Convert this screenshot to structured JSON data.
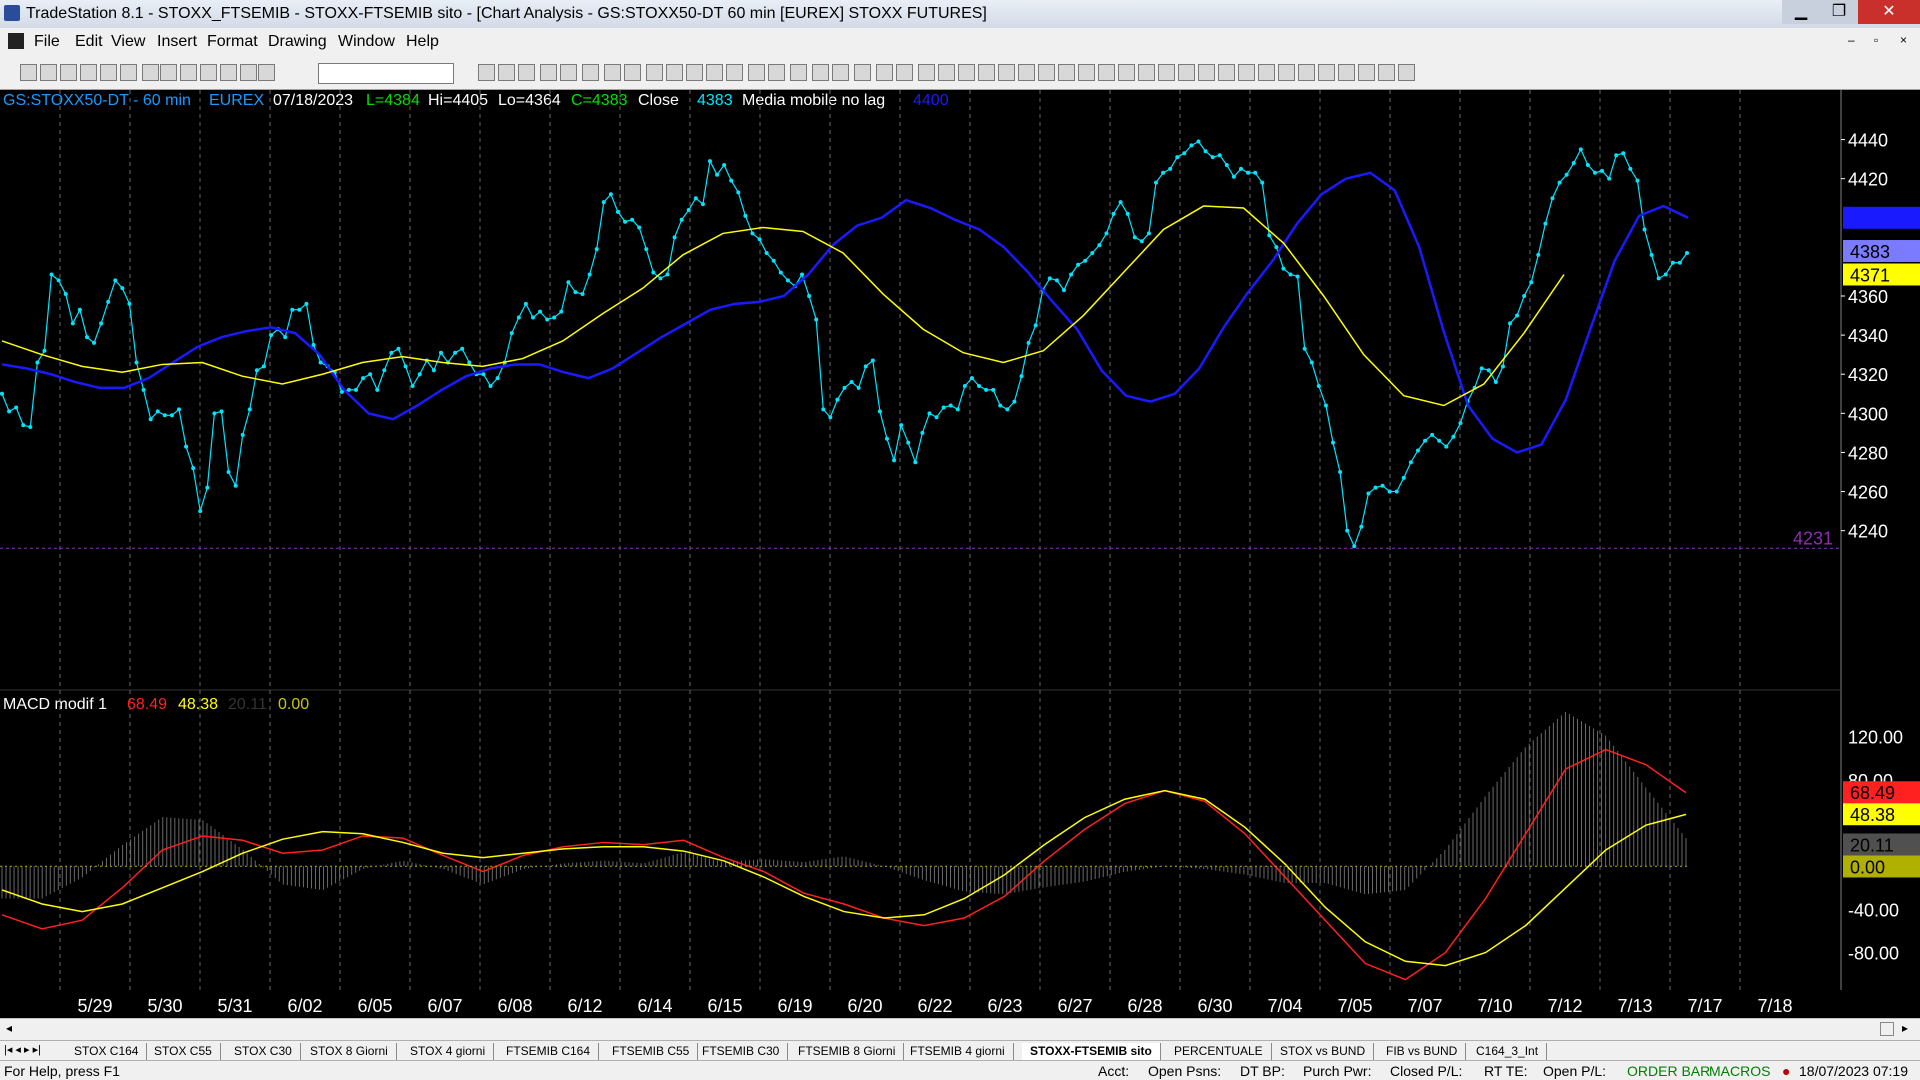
{
  "window": {
    "title": "TradeStation 8.1 - STOXX_FTSEMIB - STOXX-FTSEMIB sito - [Chart Analysis - GS:STOXX50-DT  60 min  [EUREX] STOXX FUTURES]",
    "minimize": "▁",
    "maximize": "❐",
    "close": "✕"
  },
  "menu": {
    "items": [
      "File",
      "Edit",
      "View",
      "Insert",
      "Format",
      "Drawing",
      "Window",
      "Help"
    ]
  },
  "toolbar": {
    "combo_value": ""
  },
  "chart_header": {
    "symbol": "GS:STOXX50-DT - 60 min",
    "exchange": "EUREX",
    "date": "07/18/2023",
    "last": "L=4384",
    "high": "Hi=4405",
    "low": "Lo=4364",
    "close": "C=4383",
    "close_label": "Close",
    "close_value": "4383",
    "ma_label": "Media mobile no lag",
    "ma_value": "4400"
  },
  "macd_header": {
    "name": "MACD modif 1",
    "v1": "68.49",
    "v2": "48.38",
    "v3": "20.11",
    "v4": "0.00"
  },
  "chart_data": [
    {
      "type": "line",
      "title": "",
      "x_axis_dates": [
        "5/29",
        "5/30",
        "5/31",
        "6/02",
        "6/05",
        "6/07",
        "6/08",
        "6/12",
        "6/14",
        "6/15",
        "6/19",
        "6/20",
        "6/22",
        "6/23",
        "6/27",
        "6/28",
        "6/30",
        "7/04",
        "7/05",
        "7/07",
        "7/10",
        "7/12",
        "7/13",
        "7/17",
        "7/18"
      ],
      "y_ticks": [
        "4440",
        "4420",
        "4400",
        "4383",
        "4371",
        "4360",
        "4340",
        "4320",
        "4300",
        "4280",
        "4260",
        "4240"
      ],
      "ylim": [
        4225,
        4450
      ],
      "price_marker_4231": "4231",
      "series": [
        {
          "name": "Close",
          "color": "#00e5ff",
          "values": [
            4310,
            4301,
            4303,
            4294,
            4293,
            4326,
            4332,
            4371,
            4368,
            4361,
            4346,
            4353,
            4339,
            4336,
            4346,
            4357,
            4368,
            4364,
            4356,
            4326,
            4312,
            4297,
            4301,
            4299,
            4299,
            4302,
            4283,
            4272,
            4250,
            4262,
            4300,
            4301,
            4270,
            4263,
            4289,
            4302,
            4322,
            4324,
            4340,
            4343,
            4339,
            4353,
            4353,
            4356,
            4335,
            4326,
            4324,
            4321,
            4311,
            4312,
            4312,
            4318,
            4320,
            4312,
            4322,
            4331,
            4333,
            4324,
            4314,
            4320,
            4327,
            4322,
            4331,
            4326,
            4331,
            4333,
            4326,
            4320,
            4320,
            4314,
            4318,
            4326,
            4341,
            4349,
            4356,
            4349,
            4352,
            4348,
            4349,
            4352,
            4367,
            4362,
            4361,
            4371,
            4384,
            4408,
            4412,
            4403,
            4398,
            4399,
            4395,
            4384,
            4372,
            4369,
            4371,
            4390,
            4399,
            4404,
            4410,
            4407,
            4429,
            4422,
            4427,
            4419,
            4413,
            4401,
            4392,
            4389,
            4382,
            4378,
            4372,
            4368,
            4365,
            4371,
            4360,
            4348,
            4302,
            4298,
            4307,
            4313,
            4316,
            4313,
            4324,
            4327,
            4301,
            4287,
            4276,
            4294,
            4285,
            4275,
            4290,
            4300,
            4298,
            4303,
            4304,
            4302,
            4314,
            4318,
            4314,
            4312,
            4312,
            4304,
            4302,
            4306,
            4319,
            4336,
            4345,
            4363,
            4369,
            4368,
            4363,
            4371,
            4376,
            4378,
            4382,
            4386,
            4392,
            4402,
            4408,
            4402,
            4390,
            4388,
            4392,
            4418,
            4423,
            4425,
            4431,
            4433,
            4437,
            4439,
            4434,
            4431,
            4432,
            4427,
            4421,
            4425,
            4423,
            4423,
            4418,
            4391,
            4385,
            4374,
            4371,
            4370,
            4333,
            4326,
            4314,
            4304,
            4285,
            4270,
            4240,
            4232,
            4242,
            4259,
            4262,
            4263,
            4260,
            4260,
            4267,
            4275,
            4281,
            4286,
            4289,
            4286,
            4283,
            4288,
            4295,
            4306,
            4313,
            4323,
            4322,
            4316,
            4324,
            4346,
            4350,
            4360,
            4367,
            4381,
            4397,
            4410,
            4418,
            4422,
            4428,
            4435,
            4427,
            4423,
            4424,
            4420,
            4432,
            4433,
            4425,
            4419,
            4394,
            4381,
            4369,
            4371,
            4377,
            4377,
            4382
          ]
        },
        {
          "name": "Media mobile no lag",
          "color": "#1a1aff",
          "values": [
            4325,
            4323,
            4320,
            4316,
            4313,
            4313,
            4318,
            4326,
            4334,
            4339,
            4342,
            4344,
            4341,
            4330,
            4312,
            4300,
            4297,
            4304,
            4312,
            4319,
            4323,
            4325,
            4325,
            4321,
            4318,
            4323,
            4331,
            4339,
            4346,
            4353,
            4356,
            4357,
            4360,
            4371,
            4386,
            4396,
            4400,
            4409,
            4405,
            4399,
            4394,
            4385,
            4372,
            4357,
            4343,
            4322,
            4309,
            4306,
            4310,
            4323,
            4344,
            4362,
            4378,
            4397,
            4412,
            4420,
            4423,
            4414,
            4385,
            4342,
            4304,
            4287,
            4280,
            4284,
            4307,
            4343,
            4378,
            4401,
            4406,
            4400
          ]
        },
        {
          "name": "Average",
          "color": "#ffff00",
          "values": [
            4337,
            4330,
            4324,
            4321,
            4325,
            4326,
            4319,
            4315,
            4320,
            4326,
            4329,
            4326,
            4324,
            4328,
            4337,
            4351,
            4364,
            4381,
            4392,
            4395,
            4393,
            4382,
            4361,
            4343,
            4331,
            4326,
            4332,
            4350,
            4372,
            4394,
            4406,
            4405,
            4387,
            4360,
            4330,
            4309,
            4304,
            4315,
            4341,
            4371
          ]
        }
      ]
    },
    {
      "type": "bar",
      "title": "",
      "y_ticks": [
        "120.00",
        "80.00",
        "40.00",
        "0.00",
        "-40.00",
        "-80.00"
      ],
      "ylim": [
        -110,
        140
      ],
      "series": [
        {
          "name": "MACD",
          "color": "#ff2020",
          "values": [
            -45,
            -58,
            -50,
            -20,
            15,
            28,
            24,
            12,
            15,
            28,
            26,
            10,
            -5,
            10,
            18,
            22,
            20,
            24,
            8,
            -5,
            -25,
            -35,
            -48,
            -55,
            -48,
            -28,
            5,
            34,
            58,
            70,
            60,
            30,
            -10,
            -50,
            -90,
            -105,
            -80,
            -30,
            30,
            90,
            108,
            94,
            68
          ]
        },
        {
          "name": "Signal",
          "color": "#ffff00",
          "values": [
            -22,
            -35,
            -42,
            -35,
            -20,
            -5,
            12,
            25,
            32,
            30,
            22,
            12,
            8,
            12,
            16,
            18,
            18,
            14,
            5,
            -10,
            -28,
            -42,
            -48,
            -45,
            -30,
            -8,
            20,
            45,
            62,
            70,
            62,
            36,
            2,
            -38,
            -70,
            -88,
            -92,
            -80,
            -55,
            -20,
            15,
            38,
            48
          ]
        },
        {
          "name": "Histogram",
          "color": "#808080",
          "values": [
            -23,
            -23,
            -8,
            15,
            35,
            33,
            12,
            -13,
            -17,
            -2,
            4,
            -2,
            -13,
            -2,
            2,
            4,
            2,
            10,
            3,
            5,
            3,
            7,
            0,
            -10,
            -18,
            -20,
            -15,
            -11,
            -4,
            0,
            -2,
            -6,
            -12,
            -12,
            -20,
            -17,
            12,
            50,
            85,
            110,
            93,
            56,
            20
          ]
        }
      ]
    }
  ],
  "tabs": [
    "STOX C164",
    "STOX C55",
    "STOX  C30",
    "STOX  8 Giorni",
    "STOX 4 giorni",
    "FTSEMIB C164",
    "FTSEMIB C55",
    "FTSEMIB C30",
    "FTSEMIB  8 Giorni",
    "FTSEMIB  4 giorni",
    "STOXX-FTSEMIB sito",
    "PERCENTUALE",
    "STOX vs BUND",
    "FIB vs BUND",
    "C164_3_Int"
  ],
  "active_tab": "STOXX-FTSEMIB sito",
  "status": {
    "help": "For Help, press F1",
    "acct": "Acct:",
    "open_psns": "Open Psns:",
    "dt_bp": "DT BP:",
    "purch_pwr": "Purch Pwr:",
    "closed_pl": "Closed P/L:",
    "rt_te": "RT TE:",
    "open_pl": "Open P/L:",
    "order_bar": "ORDER BAR",
    "macros": "MACROS",
    "datetime": "18/07/2023 07:19"
  },
  "colors": {
    "cyan": "#00e5ff",
    "blue": "#1a1aff",
    "yellow": "#ffff00",
    "red": "#ff2020",
    "purple": "#8b2fb0",
    "green": "#00d000"
  }
}
